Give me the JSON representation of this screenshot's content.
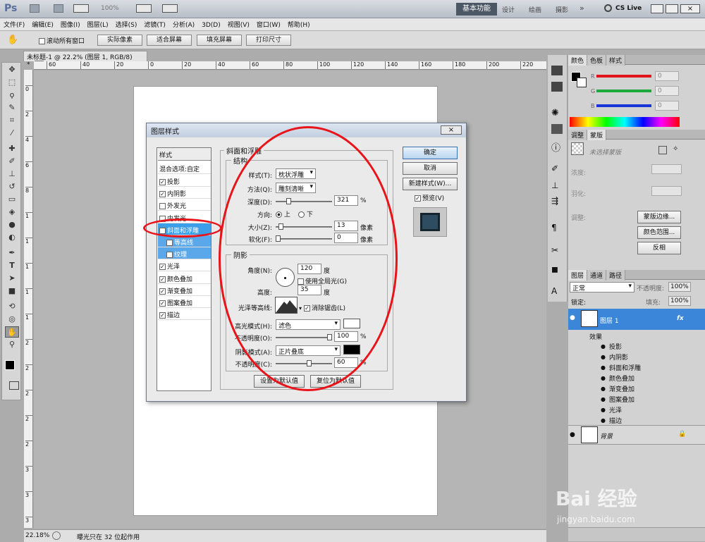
{
  "app": {
    "logo": "Ps",
    "workspace": "基本功能",
    "workspaces": [
      "设计",
      "绘画",
      "摄影"
    ],
    "more": "»",
    "cslive": "CS Live",
    "zoom_box": "100%"
  },
  "menu": [
    "文件(F)",
    "编辑(E)",
    "图像(I)",
    "图层(L)",
    "选择(S)",
    "滤镜(T)",
    "分析(A)",
    "3D(D)",
    "视图(V)",
    "窗口(W)",
    "帮助(H)"
  ],
  "options": {
    "scroll_all": "滚动所有窗口",
    "btn_actual": "实际像素",
    "btn_fit": "适合屏幕",
    "btn_fill": "填充屏幕",
    "btn_print": "打印尺寸"
  },
  "doc": {
    "tab": "未标题-1 @ 22.2% (图层 1, RGB/8) *",
    "ruler_h": [
      "60",
      "40",
      "20",
      "0",
      "20",
      "40",
      "60",
      "80",
      "100",
      "120",
      "140",
      "160",
      "180",
      "200",
      "220",
      "240"
    ],
    "ruler_v": [
      "0",
      "2",
      "4",
      "6",
      "8",
      "1",
      "1",
      "1",
      "1",
      "1",
      "2",
      "2",
      "2",
      "2",
      "2",
      "3",
      "3",
      "3"
    ]
  },
  "status": {
    "zoom": "22.18%",
    "msg": "曝光只在 32 位起作用"
  },
  "dialog": {
    "title": "图层样式",
    "style_list_header": "样式",
    "blend": "混合选项:自定",
    "items": [
      {
        "label": "投影",
        "checked": true
      },
      {
        "label": "内阴影",
        "checked": true
      },
      {
        "label": "外发光",
        "checked": false
      },
      {
        "label": "内发光",
        "checked": false
      },
      {
        "label": "斜面和浮雕",
        "checked": true
      },
      {
        "label": "等高线",
        "checked": false
      },
      {
        "label": "纹理",
        "checked": false
      },
      {
        "label": "光泽",
        "checked": true
      },
      {
        "label": "颜色叠加",
        "checked": true
      },
      {
        "label": "渐变叠加",
        "checked": true
      },
      {
        "label": "图案叠加",
        "checked": true
      },
      {
        "label": "描边",
        "checked": true
      }
    ],
    "section": "斜面和浮雕",
    "structure": "结构",
    "style_label": "样式(T):",
    "style_value": "枕状浮雕",
    "method_label": "方法(Q):",
    "method_value": "雕刻清晰",
    "depth_label": "深度(D):",
    "depth_value": "321",
    "depth_unit": "%",
    "depth_pos": 0.21,
    "direction_label": "方向:",
    "dir_up": "上",
    "dir_down": "下",
    "size_label": "大小(Z):",
    "size_value": "13",
    "size_unit": "像素",
    "size_pos": 0.05,
    "soften_label": "软化(F):",
    "soften_value": "0",
    "soften_unit": "像素",
    "soften_pos": 0.0,
    "shading": "阴影",
    "angle_label": "角度(N):",
    "angle_value": "120",
    "angle_unit": "度",
    "global_light": "使用全局光(G)",
    "global_checked": false,
    "altitude_label": "高度:",
    "altitude_value": "35",
    "altitude_unit": "度",
    "gloss_label": "光泽等高线:",
    "antialias": "消除锯齿(L)",
    "antialias_checked": true,
    "hl_mode_label": "高光模式(H):",
    "hl_mode_value": "滤色",
    "hl_color": "#ffffff",
    "hl_opacity_label": "不透明度(O):",
    "hl_opacity_value": "100",
    "hl_opacity_unit": "%",
    "hl_opacity_pos": 1.0,
    "sh_mode_label": "阴影模式(A):",
    "sh_mode_value": "正片叠底",
    "sh_color": "#000000",
    "sh_opacity_label": "不透明度(C):",
    "sh_opacity_value": "60",
    "sh_opacity_unit": "%",
    "sh_opacity_pos": 0.6,
    "set_default": "设置为默认值",
    "reset_default": "复位为默认值",
    "ok": "确定",
    "cancel": "取消",
    "new_style": "新建样式(W)...",
    "preview": "预览(V)",
    "preview_checked": true
  },
  "panels": {
    "color_tabs": [
      "颜色",
      "色板",
      "样式"
    ],
    "rgb": [
      {
        "ch": "R",
        "val": "0",
        "color": "#e0141a"
      },
      {
        "ch": "G",
        "val": "0",
        "color": "#1ca83a"
      },
      {
        "ch": "B",
        "val": "0",
        "color": "#1836d8"
      }
    ],
    "adjust_tabs": [
      "调整",
      "蒙版"
    ],
    "mask_label": "未选择蒙版",
    "density": "浓度:",
    "feather": "羽化:",
    "refine": "调整:",
    "mask_edge": "蒙版边缘...",
    "color_range": "颜色范围...",
    "invert": "反相",
    "layers_tabs": [
      "图层",
      "通道",
      "路径"
    ],
    "blend_mode": "正常",
    "opacity_label": "不透明度:",
    "opacity_value": "100%",
    "lock_label": "锁定:",
    "fill_label": "填充:",
    "fill_value": "100%",
    "layer1": "图层 1",
    "fx": "fx",
    "effects": "效果",
    "effects_list": [
      "投影",
      "内阴影",
      "斜面和浮雕",
      "颜色叠加",
      "渐变叠加",
      "图案叠加",
      "光泽",
      "描边"
    ],
    "background": "背景"
  },
  "watermark": {
    "site": "Bai  经验",
    "url": "jingyan.baidu.com"
  }
}
